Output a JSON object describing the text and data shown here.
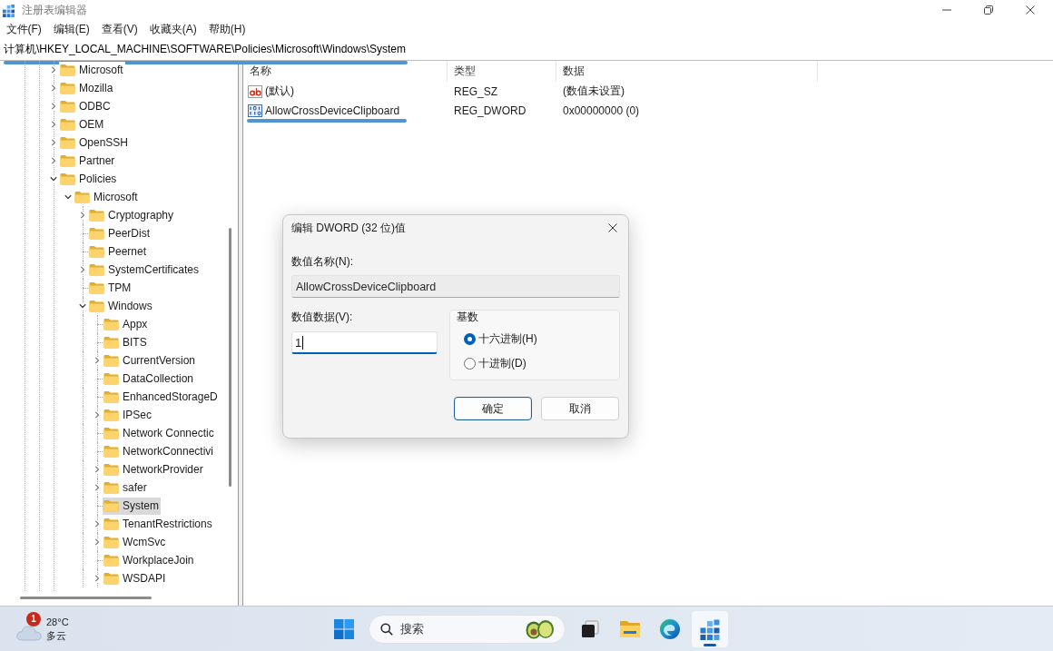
{
  "window": {
    "title": "注册表编辑器"
  },
  "menu": [
    "文件(F)",
    "编辑(E)",
    "查看(V)",
    "收藏夹(A)",
    "帮助(H)"
  ],
  "address_bar": {
    "path": "计算机\\HKEY_LOCAL_MACHINE\\SOFTWARE\\Policies\\Microsoft\\Windows\\System",
    "underlined": true
  },
  "tree": [
    {
      "name": "Microsoft",
      "expandable": true,
      "expanded": false,
      "selected": false
    },
    {
      "name": "Mozilla",
      "expandable": true,
      "expanded": false,
      "selected": false
    },
    {
      "name": "ODBC",
      "expandable": true,
      "expanded": false,
      "selected": false
    },
    {
      "name": "OEM",
      "expandable": true,
      "expanded": false,
      "selected": false
    },
    {
      "name": "OpenSSH",
      "expandable": true,
      "expanded": false,
      "selected": false
    },
    {
      "name": "Partner",
      "expandable": true,
      "expanded": false,
      "selected": false
    },
    {
      "name": "Policies",
      "expandable": true,
      "expanded": true,
      "selected": false,
      "children": [
        {
          "name": "Microsoft",
          "expandable": true,
          "expanded": true,
          "selected": false,
          "children": [
            {
              "name": "Cryptography",
              "expandable": true,
              "expanded": false,
              "selected": false
            },
            {
              "name": "PeerDist",
              "expandable": false,
              "selected": false
            },
            {
              "name": "Peernet",
              "expandable": false,
              "selected": false
            },
            {
              "name": "SystemCertificates",
              "expandable": true,
              "expanded": false,
              "selected": false
            },
            {
              "name": "TPM",
              "expandable": false,
              "selected": false
            },
            {
              "name": "Windows",
              "expandable": true,
              "expanded": true,
              "selected": false,
              "children": [
                {
                  "name": "Appx",
                  "expandable": false,
                  "selected": false
                },
                {
                  "name": "BITS",
                  "expandable": false,
                  "selected": false
                },
                {
                  "name": "CurrentVersion",
                  "expandable": true,
                  "expanded": false,
                  "selected": false
                },
                {
                  "name": "DataCollection",
                  "expandable": false,
                  "selected": false
                },
                {
                  "name": "EnhancedStorageD",
                  "expandable": false,
                  "selected": false
                },
                {
                  "name": "IPSec",
                  "expandable": true,
                  "expanded": false,
                  "selected": false
                },
                {
                  "name": "Network Connectic",
                  "expandable": false,
                  "selected": false
                },
                {
                  "name": "NetworkConnectivi",
                  "expandable": false,
                  "selected": false
                },
                {
                  "name": "NetworkProvider",
                  "expandable": true,
                  "expanded": false,
                  "selected": false
                },
                {
                  "name": "safer",
                  "expandable": true,
                  "expanded": false,
                  "selected": false
                },
                {
                  "name": "System",
                  "expandable": false,
                  "selected": true
                },
                {
                  "name": "TenantRestrictions",
                  "expandable": true,
                  "expanded": false,
                  "selected": false
                },
                {
                  "name": "WcmSvc",
                  "expandable": true,
                  "expanded": false,
                  "selected": false
                },
                {
                  "name": "WorkplaceJoin",
                  "expandable": false,
                  "selected": false
                },
                {
                  "name": "WSDAPI",
                  "expandable": true,
                  "expanded": false,
                  "selected": false
                }
              ]
            }
          ]
        }
      ]
    }
  ],
  "values": {
    "columns": [
      "名称",
      "类型",
      "数据"
    ],
    "rows": [
      {
        "kind": "string",
        "name": "(默认)",
        "type": "REG_SZ",
        "data": "(数值未设置)",
        "selected": false,
        "underlined": false
      },
      {
        "kind": "binary",
        "name": "AllowCrossDeviceClipboard",
        "type": "REG_DWORD",
        "data": "0x00000000 (0)",
        "selected": false,
        "underlined": true
      }
    ]
  },
  "dialog": {
    "title": "编辑 DWORD (32 位)值",
    "value_name": {
      "label": "数值名称(N):",
      "value": "AllowCrossDeviceClipboard",
      "disabled": true
    },
    "value_data": {
      "label": "数值数据(V):",
      "value": "1",
      "focused": true
    },
    "base": {
      "title": "基数",
      "options": [
        {
          "label": "十六进制(H)",
          "selected": true
        },
        {
          "label": "十进制(D)",
          "selected": false
        }
      ]
    },
    "buttons": [
      {
        "label": "确定",
        "default": true
      },
      {
        "label": "取消",
        "default": false
      }
    ]
  },
  "taskbar": {
    "weather": {
      "badge": "1",
      "temperature": "28°C",
      "condition": "多云"
    },
    "search": {
      "placeholder": "搜索"
    },
    "apps": [
      {
        "kind": "task-view",
        "active": false
      },
      {
        "kind": "file-explorer",
        "active": false
      },
      {
        "kind": "browser",
        "active": false
      },
      {
        "kind": "registry",
        "active": true
      }
    ]
  }
}
